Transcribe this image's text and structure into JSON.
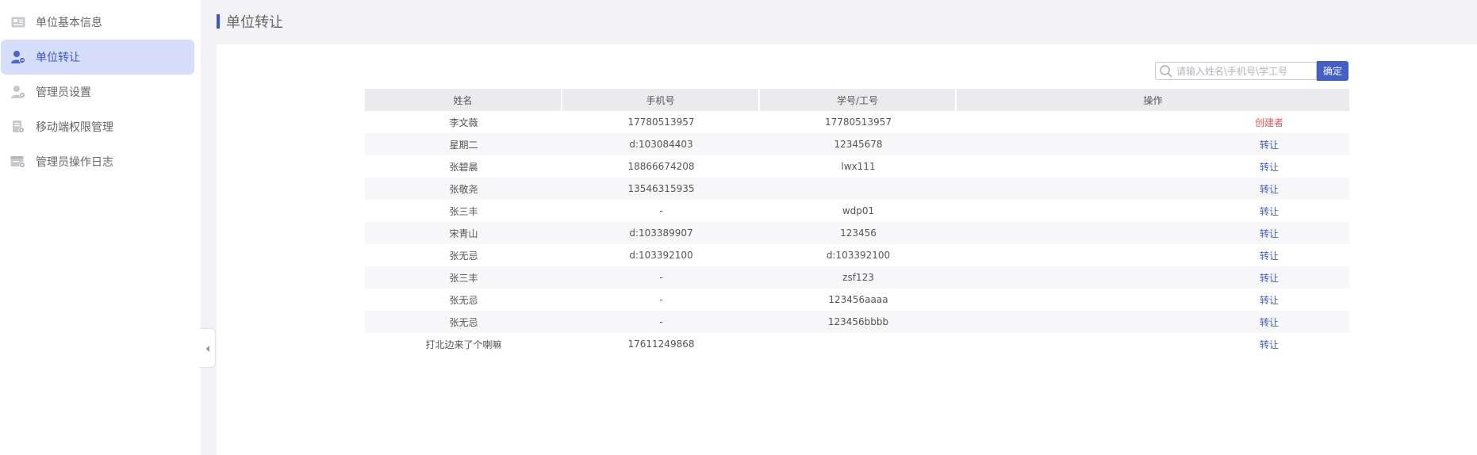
{
  "sidebar": {
    "items": [
      {
        "label": "单位基本信息",
        "icon": "info-card-icon",
        "active": false
      },
      {
        "label": "单位转让",
        "icon": "user-transfer-icon",
        "active": true
      },
      {
        "label": "管理员设置",
        "icon": "admin-gear-icon",
        "active": false
      },
      {
        "label": "移动端权限管理",
        "icon": "mobile-permission-icon",
        "active": false
      },
      {
        "label": "管理员操作日志",
        "icon": "log-gear-icon",
        "active": false
      }
    ]
  },
  "header": {
    "title": "单位转让"
  },
  "search": {
    "placeholder": "请输入姓名\\手机号\\学工号",
    "value": "",
    "button_label": "确定"
  },
  "table": {
    "headers": [
      "姓名",
      "手机号",
      "学号/工号",
      "操作"
    ],
    "rows": [
      {
        "name": "李文薇",
        "phone": "17780513957",
        "id": "17780513957",
        "action": "创建者"
      },
      {
        "name": "星期二",
        "phone": "d:103084403",
        "id": "12345678",
        "action": "转让"
      },
      {
        "name": "张碧晨",
        "phone": "18866674208",
        "id": "lwx111",
        "action": "转让"
      },
      {
        "name": "张敬尧",
        "phone": "13546315935",
        "id": "",
        "action": "转让"
      },
      {
        "name": "张三丰",
        "phone": "-",
        "id": "wdp01",
        "action": "转让"
      },
      {
        "name": "宋青山",
        "phone": "d:103389907",
        "id": "123456",
        "action": "转让"
      },
      {
        "name": "张无忌",
        "phone": "d:103392100",
        "id": "d:103392100",
        "action": "转让"
      },
      {
        "name": "张三丰",
        "phone": "-",
        "id": "zsf123",
        "action": "转让"
      },
      {
        "name": "张无忌",
        "phone": "-",
        "id": "123456aaaa",
        "action": "转让"
      },
      {
        "name": "张无忌",
        "phone": "-",
        "id": "123456bbbb",
        "action": "转让"
      },
      {
        "name": "打北边来了个喇嘛",
        "phone": "17611249868",
        "id": "",
        "action": "转让"
      }
    ]
  },
  "colors": {
    "accent": "#3c56c6",
    "active_bg": "#d7def9",
    "creator": "#f05555",
    "link": "#3f5bc6"
  }
}
